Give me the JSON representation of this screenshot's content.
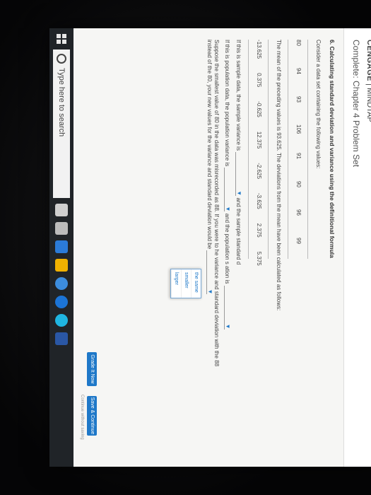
{
  "brand": {
    "name": "CENGAGE",
    "product": "MINDTAP"
  },
  "assignment": {
    "title": "Complete: Chapter 4 Problem Set"
  },
  "problem": {
    "heading": "6. Calculating standard deviation and variance using the definitional formula",
    "intro": "Consider a data set containing the following values:",
    "values": [
      "80",
      "94",
      "93",
      "106",
      "91",
      "90",
      "96",
      "99"
    ],
    "mean_text": "The mean of the preceding values is 93.625. The deviations from the mean have been calculated as follows:",
    "deviations": [
      "-13.625",
      "0.375",
      "-0.625",
      "12.375",
      "-2.625",
      "-3.625",
      "2.375",
      "5.375"
    ],
    "sample_q_prefix": "If this is sample data, the sample variance is",
    "sample_q_suffix": "and the sample standard d",
    "population_q_prefix": "If this is population data, the population variance is",
    "population_q_suffix": "and the population s",
    "population_q_end": "ation is",
    "suppose_text_1": "Suppose the smallest value of 80 in the data was misrecorded as 88. If you were to",
    "suppose_text_2": "he variance and standard deviation with the 88",
    "suppose_text_3": "instead of the 80, your new values for the variance and standard deviation would be",
    "menu_options": [
      "the same",
      "smaller",
      "larger"
    ]
  },
  "buttons": {
    "grade": "Grade It Now",
    "save": "Save & Continue",
    "continue": "Continue without saving"
  },
  "taskbar": {
    "search_placeholder": "Type here to search"
  }
}
